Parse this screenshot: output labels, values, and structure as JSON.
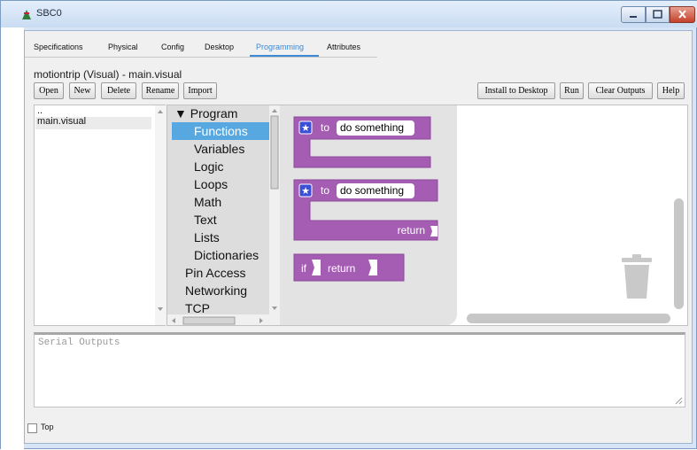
{
  "window": {
    "title": "SBC0"
  },
  "tabs": [
    {
      "label": "Specifications",
      "active": false
    },
    {
      "label": "Physical",
      "active": false
    },
    {
      "label": "Config",
      "active": false
    },
    {
      "label": "Desktop",
      "active": false
    },
    {
      "label": "Programming",
      "active": true
    },
    {
      "label": "Attributes",
      "active": false
    }
  ],
  "file": {
    "label": "motiontrip (Visual) - main.visual"
  },
  "toolbar": {
    "left": [
      "Open",
      "New",
      "Delete",
      "Rename",
      "Import"
    ],
    "right": [
      "Install to Desktop",
      "Run",
      "Clear Outputs",
      "Help"
    ]
  },
  "explorer": {
    "items": [
      "..",
      "main.visual"
    ],
    "selected": "main.visual"
  },
  "toolbox": {
    "program_label": "Program",
    "arrow": "▼",
    "selected": "Functions",
    "subcategories": [
      "Functions",
      "Variables",
      "Logic",
      "Loops",
      "Math",
      "Text",
      "Lists",
      "Dictionaries"
    ],
    "categories": [
      "Pin Access",
      "Networking",
      "TCP"
    ]
  },
  "blocks": {
    "proc1": {
      "prefix": "to",
      "name": "do something"
    },
    "proc2": {
      "prefix": "to",
      "name": "do something",
      "return_label": "return"
    },
    "ifreturn": {
      "if_label": "if",
      "return_label": "return"
    },
    "color": "#a55cb3"
  },
  "serial": {
    "placeholder": "Serial Outputs"
  },
  "footer": {
    "top_label": "Top",
    "top_checked": false
  },
  "colors": {
    "accent": "#3c8ad6",
    "selection": "#57a8e0"
  },
  "icons": [
    "app-icon",
    "minimize-icon",
    "maximize-icon",
    "close-icon",
    "gear-icon",
    "trash-icon",
    "resize-grip-icon"
  ]
}
